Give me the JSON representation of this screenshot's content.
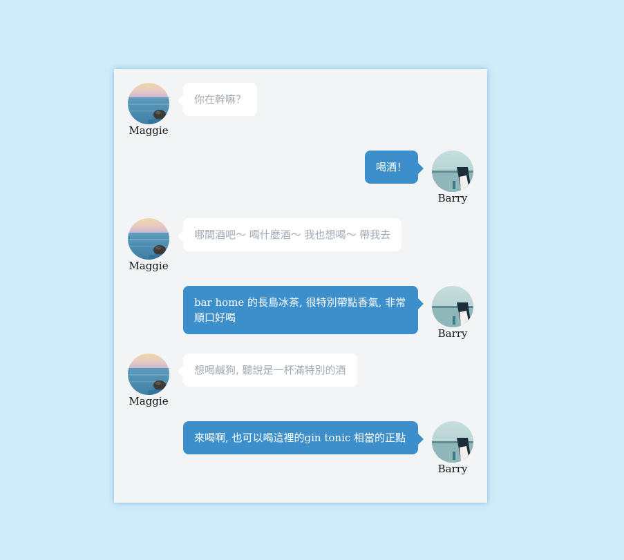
{
  "users": {
    "maggie": {
      "name": "Maggie",
      "avatar_icon": "sea-rock-avatar-icon"
    },
    "barry": {
      "name": "Barry",
      "avatar_icon": "sea-bottle-avatar-icon"
    }
  },
  "colors": {
    "page_background": "#d1ecf9",
    "panel_background": "#f3f4f6",
    "incoming_bubble": "#ffffff",
    "incoming_text": "#a0aab5",
    "outgoing_bubble": "#3d8fcb",
    "outgoing_text": "#ffffff"
  },
  "messages": [
    {
      "sender": "Maggie",
      "side": "left",
      "text": "你在幹嘛？"
    },
    {
      "sender": "Barry",
      "side": "right",
      "text": "喝酒！"
    },
    {
      "sender": "Maggie",
      "side": "left",
      "text": "哪間酒吧～ 喝什麼酒～ 我也想喝～ 帶我去"
    },
    {
      "sender": "Barry",
      "side": "right",
      "text": "bar home 的長島冰茶, 很特別帶點香氣, 非常順口好喝"
    },
    {
      "sender": "Maggie",
      "side": "left",
      "text": "想喝鹹狗, 聽說是一杯滿特別的酒"
    },
    {
      "sender": "Barry",
      "side": "right",
      "text": "來喝啊, 也可以喝這裡的gin tonic 相當的正點"
    }
  ]
}
